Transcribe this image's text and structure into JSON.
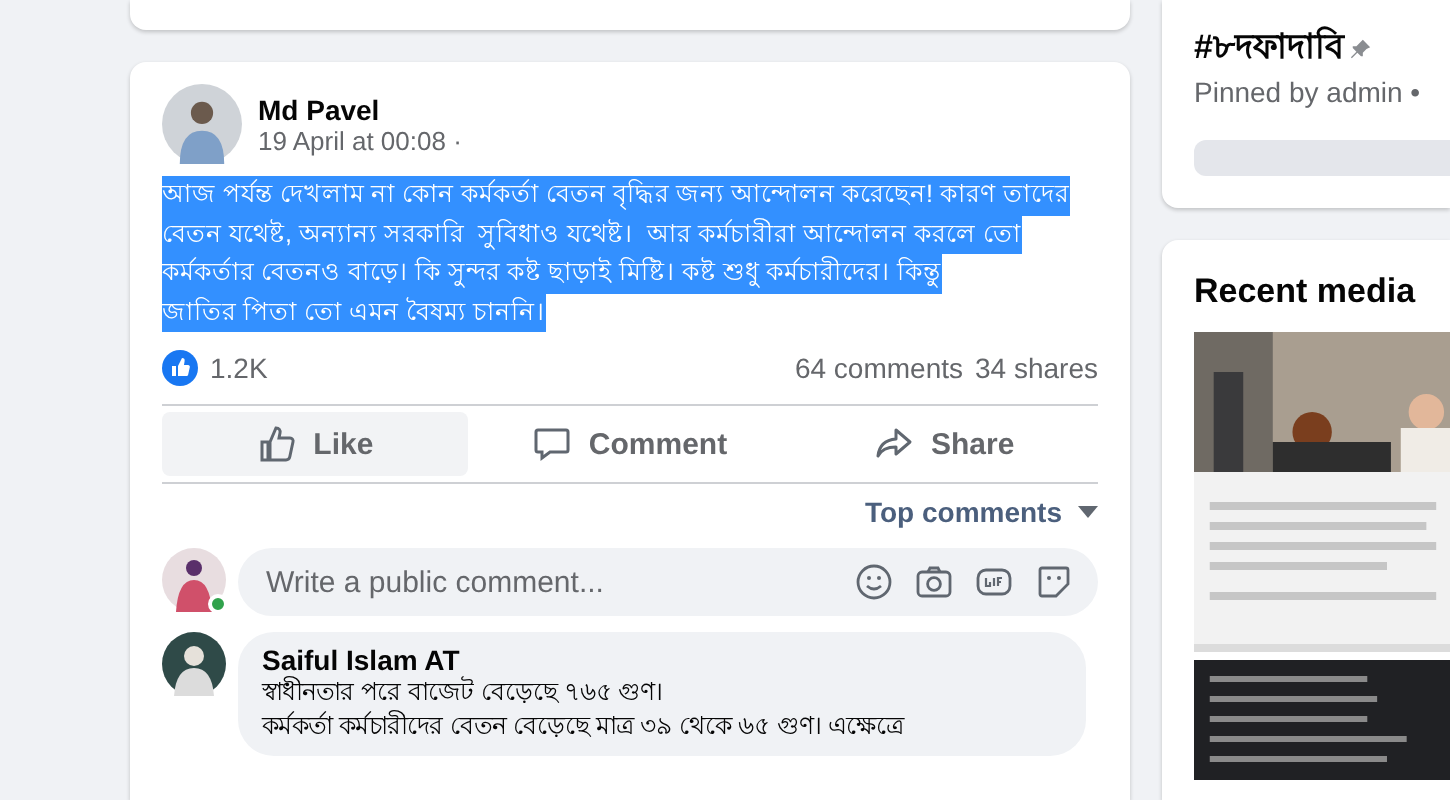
{
  "post": {
    "author": "Md Pavel",
    "time": "19 April at 00:08 ·",
    "highlighted": true,
    "lines": [
      "আজ পর্যন্ত দেখলাম না কোন কর্মকর্তা বেতন বৃদ্ধির জন্য আন্দোলন করেছেন! কারণ তাদের",
      "বেতন যথেষ্ট, অন্যান্য সরকারি  সুবিধাও যথেষ্ট।  আর কর্মচারীরা আন্দোলন করলে তো",
      "কর্মকর্তার বেতনও বাড়ে। কি সুন্দর কষ্ট ছাড়াই মিষ্টি। কষ্ট শুধু কর্মচারীদের। কিন্তু",
      "জাতির পিতা তো এমন বৈষম্য চাননি।"
    ],
    "reactions": "1.2K",
    "comments": "64 comments",
    "shares": "34 shares",
    "actions": [
      {
        "kind": "like",
        "label": "Like",
        "selected": true
      },
      {
        "kind": "comment",
        "label": "Comment",
        "selected": false
      },
      {
        "kind": "share",
        "label": "Share",
        "selected": false
      }
    ],
    "sort": "Top comments",
    "comment_field": {
      "placeholder": "Write a public comment...",
      "online": true
    },
    "comment": {
      "author": "Saiful Islam AT",
      "lines": [
        "স্বাধীনতার পরে বাজেট বেড়েছে ৭৬৫ গুণ।",
        "কর্মকর্তা কর্মচারীদের বেতন বেড়েছে মাত্র ৩৯ থেকে ৬৫ গুণ। এক্ষেত্রে"
      ]
    }
  },
  "sidebar": {
    "hashtag": "#৮দফাদাবি",
    "pinned": "Pinned by admin •",
    "media_title": "Recent media"
  }
}
